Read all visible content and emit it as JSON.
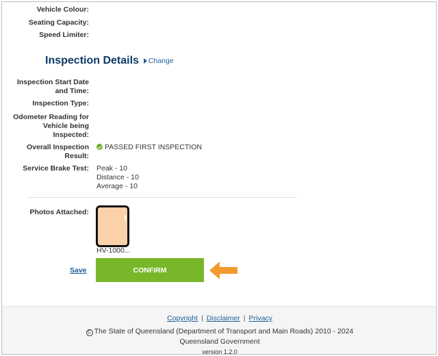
{
  "vehicle": {
    "colour_label": "Vehicle Colour:",
    "seating_label": "Seating Capacity:",
    "speed_limiter_label": "Speed Limiter:"
  },
  "inspection": {
    "title": "Inspection Details",
    "change_label": "Change",
    "start_label_line1": "Inspection Start Date",
    "start_label_line2": "and Time:",
    "type_label": "Inspection Type:",
    "odometer_line1": "Odometer Reading for",
    "odometer_line2": "Vehicle being",
    "odometer_line3": "Inspected:",
    "result_label_line1": "Overall Inspection",
    "result_label_line2": "Result:",
    "result_value": "PASSED FIRST INSPECTION",
    "brake_label": "Service Brake Test:",
    "brake_values": [
      "Peak - 10",
      "Distance - 10",
      "Average - 10"
    ],
    "photos_label": "Photos Attached:",
    "photo_filename": "HV-1000..."
  },
  "actions": {
    "save_label": "Save",
    "confirm_label": "CONFIRM"
  },
  "footer": {
    "copyright_link": "Copyright",
    "disclaimer_link": "Disclaimer",
    "privacy_link": "Privacy",
    "separator": "|",
    "copyright_symbol": "C",
    "copyright_text": "The State of Queensland (Department of Transport and Main Roads) 2010 - 2024",
    "government": "Queensland Government",
    "version": "version 1.2.0"
  },
  "colors": {
    "accent_green": "#78b72a",
    "link_blue": "#1c5d99",
    "title_navy": "#0b3a66",
    "arrow_orange": "#f39a2f"
  },
  "icons": {
    "change": "caret-right-icon",
    "result": "check-circle-icon",
    "pointer": "arrow-left-icon"
  }
}
